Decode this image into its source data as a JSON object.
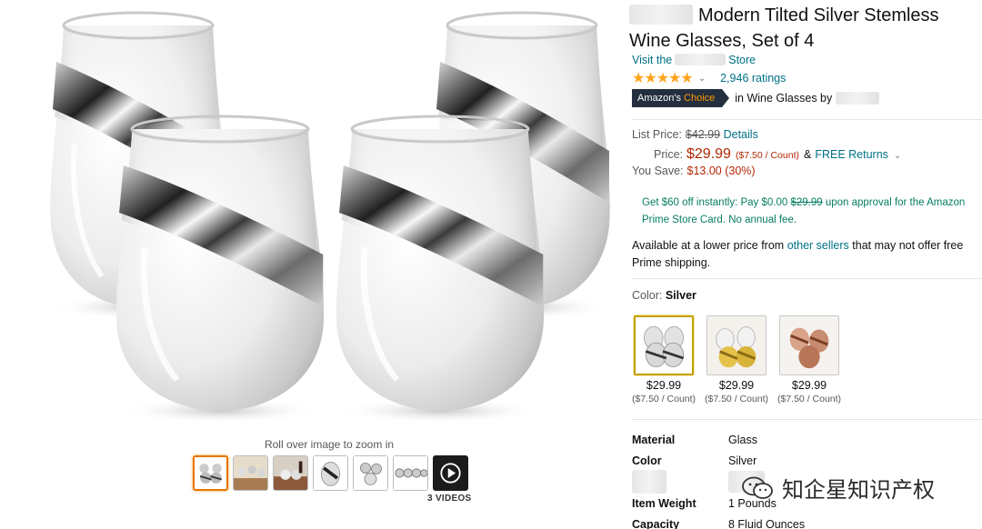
{
  "product": {
    "title": "Modern Tilted Silver Stemless Wine Glasses, Set of 4",
    "store_prefix": "Visit the",
    "store_suffix": "Store",
    "stars": "★★★★★",
    "rating_value": 4.7,
    "ratings_count": "2,946 ratings",
    "badge_part1": "Amazon's",
    "badge_part2": "Choice",
    "badge_context": "in Wine Glasses by"
  },
  "price": {
    "list_label": "List Price:",
    "list_value": "$42.99",
    "details_link": "Details",
    "price_label": "Price:",
    "price_value": "$29.99",
    "per_count": "($7.50 / Count)",
    "amp": "&",
    "free_returns": "FREE Returns",
    "save_label": "You Save:",
    "save_value": "$13.00 (30%)"
  },
  "promo": {
    "text_1": "Get $60 off instantly: Pay $0.00",
    "strike": "$29.99",
    "text_2": "upon approval for the Amazon Prime Store Card. No annual fee."
  },
  "lower_price": {
    "text_1": "Available at a lower price from",
    "link": "other sellers",
    "text_2": "that may not offer free Prime shipping."
  },
  "color": {
    "label": "Color:",
    "selected": "Silver",
    "swatches": [
      {
        "price": "$29.99",
        "per_count": "($7.50 / Count)",
        "tone": "silver"
      },
      {
        "price": "$29.99",
        "per_count": "($7.50 / Count)",
        "tone": "gold"
      },
      {
        "price": "$29.99",
        "per_count": "($7.50 / Count)",
        "tone": "copper"
      }
    ]
  },
  "specs": [
    {
      "key": "Material",
      "value": "Glass"
    },
    {
      "key": "Color",
      "value": "Silver"
    },
    {
      "key": "Item Weight",
      "value": "1 Pounds"
    },
    {
      "key": "Capacity",
      "value": "8 Fluid Ounces"
    }
  ],
  "gallery": {
    "zoom_hint": "Roll over image to zoom in",
    "videos_label": "3 VIDEOS"
  },
  "watermark": "知企星知识产权",
  "colors": {
    "link": "#007185",
    "price_red": "#b12704",
    "promo_green": "#067d62",
    "star": "#ffa41c",
    "badge_bg": "#232f3e",
    "badge_accent": "#ff9900",
    "thumb_selected": "#e77600"
  }
}
